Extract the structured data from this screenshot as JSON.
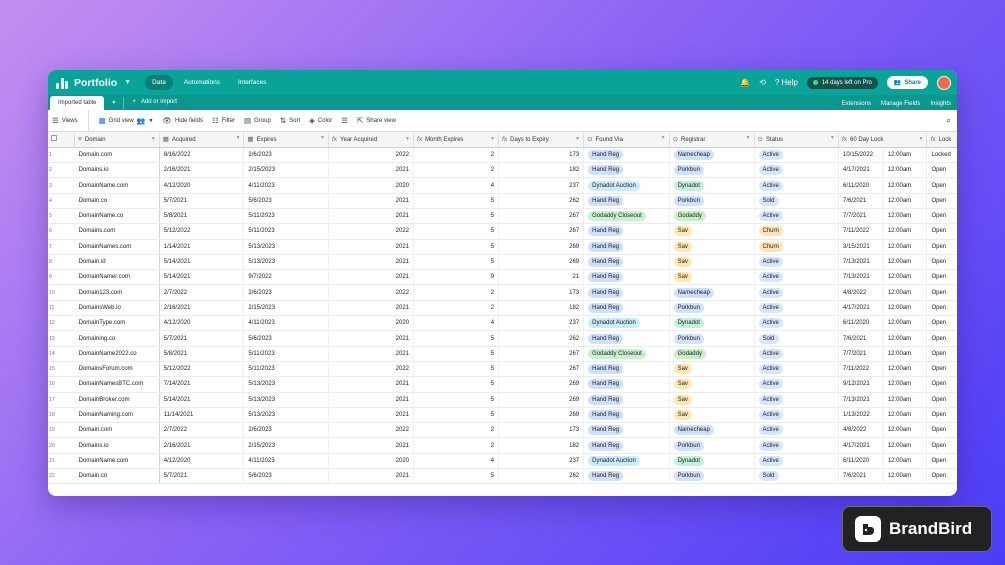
{
  "app": {
    "title": "Portfolio"
  },
  "nav": [
    "Data",
    "Automations",
    "Interfaces"
  ],
  "topbar_right": {
    "trial": "14 days left on Pro",
    "help": "Help",
    "share": "Share"
  },
  "tabbar": {
    "active_tab": "Imported table",
    "add_import": "Add or import",
    "extensions": "Extensions",
    "manage_fields": "Manage Fields",
    "insights": "Insights"
  },
  "toolbar": {
    "views": "Views",
    "grid_view": "Grid view",
    "hide_fields": "Hide fields",
    "filter": "Filter",
    "group": "Group",
    "sort": "Sort",
    "color": "Color",
    "share_view": "Share view"
  },
  "columns": [
    "Domain",
    "Acquired",
    "Expires",
    "Year Acquired",
    "Month Expires",
    "Days to Expiry",
    "Found Via",
    "Registrar",
    "Status",
    "60 Day Lock",
    "Lock"
  ],
  "rows": [
    [
      "Domain.com",
      "8/16/2022",
      "2/6/2023",
      "2022",
      "2",
      "173",
      "Hand Reg",
      "Namecheap",
      "Active",
      "10/15/2022",
      "12:00am",
      "Locked"
    ],
    [
      "Domains.io",
      "2/16/2021",
      "2/15/2023",
      "2021",
      "2",
      "182",
      "Hand Reg",
      "Porkbun",
      "Active",
      "4/17/2021",
      "12:00am",
      "Open"
    ],
    [
      "DomainName.com",
      "4/12/2020",
      "4/11/2023",
      "2020",
      "4",
      "237",
      "Dynadot Auction",
      "Dynadot",
      "Active",
      "6/11/2020",
      "12:00am",
      "Open"
    ],
    [
      "Domain.co",
      "5/7/2021",
      "5/6/2023",
      "2021",
      "5",
      "262",
      "Hand Reg",
      "Porkbun",
      "Sold",
      "7/6/2021",
      "12:00am",
      "Open"
    ],
    [
      "DomainName.co",
      "5/8/2021",
      "5/11/2023",
      "2021",
      "5",
      "267",
      "Godaddy Closeout",
      "Godaddy",
      "Active",
      "7/7/2021",
      "12:00am",
      "Open"
    ],
    [
      "Domains.com",
      "5/12/2022",
      "5/11/2023",
      "2022",
      "5",
      "267",
      "Hand Reg",
      "Sav",
      "Churn",
      "7/11/2022",
      "12:00am",
      "Open"
    ],
    [
      "DomainNames.com",
      "1/14/2021",
      "5/13/2023",
      "2021",
      "5",
      "269",
      "Hand Reg",
      "Sav",
      "Churn",
      "3/15/2021",
      "12:00am",
      "Open"
    ],
    [
      "Domain.id",
      "5/14/2021",
      "5/13/2023",
      "2021",
      "5",
      "269",
      "Hand Reg",
      "Sav",
      "Active",
      "7/13/2021",
      "12:00am",
      "Open"
    ],
    [
      "DomainNamer.com",
      "5/14/2021",
      "9/7/2022",
      "2021",
      "9",
      "21",
      "Hand Reg",
      "Sav",
      "Active",
      "7/13/2021",
      "12:00am",
      "Open"
    ],
    [
      "Domain123.com",
      "2/7/2022",
      "2/6/2023",
      "2022",
      "2",
      "173",
      "Hand Reg",
      "Namecheap",
      "Active",
      "4/8/2022",
      "12:00am",
      "Open"
    ],
    [
      "DomainsWeb.io",
      "2/16/2021",
      "2/15/2023",
      "2021",
      "2",
      "182",
      "Hand Reg",
      "Porkbun",
      "Active",
      "4/17/2021",
      "12:00am",
      "Open"
    ],
    [
      "DomainType.com",
      "4/12/2020",
      "4/11/2023",
      "2020",
      "4",
      "237",
      "Dynadot Auction",
      "Dynadot",
      "Active",
      "6/11/2020",
      "12:00am",
      "Open"
    ],
    [
      "Domaining.co",
      "5/7/2021",
      "5/6/2023",
      "2021",
      "5",
      "262",
      "Hand Reg",
      "Porkbun",
      "Sold",
      "7/6/2021",
      "12:00am",
      "Open"
    ],
    [
      "DomainName2022.co",
      "5/8/2021",
      "5/11/2023",
      "2021",
      "5",
      "267",
      "Godaddy Closeout",
      "Godaddy",
      "Active",
      "7/7/2021",
      "12:00am",
      "Open"
    ],
    [
      "DomainsForum.com",
      "5/12/2022",
      "5/11/2023",
      "2022",
      "5",
      "267",
      "Hand Reg",
      "Sav",
      "Active",
      "7/11/2022",
      "12:00am",
      "Open"
    ],
    [
      "DomainNamesBTC.com",
      "7/14/2021",
      "5/13/2023",
      "2021",
      "5",
      "269",
      "Hand Reg",
      "Sav",
      "Active",
      "9/12/2021",
      "12:00am",
      "Open"
    ],
    [
      "DomainBroker.com",
      "5/14/2021",
      "5/13/2023",
      "2021",
      "5",
      "269",
      "Hand Reg",
      "Sav",
      "Active",
      "7/13/2021",
      "12:00am",
      "Open"
    ],
    [
      "DomainNaming.com",
      "11/14/2021",
      "5/13/2023",
      "2021",
      "5",
      "269",
      "Hand Reg",
      "Sav",
      "Active",
      "1/13/2022",
      "12:00am",
      "Open"
    ],
    [
      "Domain.com",
      "2/7/2022",
      "2/6/2023",
      "2022",
      "2",
      "173",
      "Hand Reg",
      "Namecheap",
      "Active",
      "4/8/2022",
      "12:00am",
      "Open"
    ],
    [
      "Domains.io",
      "2/16/2021",
      "2/15/2023",
      "2021",
      "2",
      "182",
      "Hand Reg",
      "Porkbun",
      "Active",
      "4/17/2021",
      "12:00am",
      "Open"
    ],
    [
      "DomainName.com",
      "4/12/2020",
      "4/11/2023",
      "2020",
      "4",
      "237",
      "Dynadot Auction",
      "Dynadot",
      "Active",
      "6/11/2020",
      "12:00am",
      "Open"
    ],
    [
      "Domain.co",
      "5/7/2021",
      "5/6/2023",
      "2021",
      "5",
      "262",
      "Hand Reg",
      "Porkbun",
      "Sold",
      "7/6/2021",
      "12:00am",
      "Open"
    ]
  ],
  "pill_colors": {
    "Hand Reg": "#cfe0fc",
    "Dynadot Auction": "#c8ecfa",
    "Godaddy Closeout": "#c6f2d1",
    "Namecheap": "#cfe0fc",
    "Porkbun": "#d0e2ff",
    "Dynadot": "#c4f0de",
    "Godaddy": "#c6f2c3",
    "Sav": "#fde8b0",
    "Active": "#d6e6ff",
    "Sold": "#d8e4fb",
    "Churn": "#fde3b5"
  },
  "brand": {
    "name": "BrandBird"
  }
}
